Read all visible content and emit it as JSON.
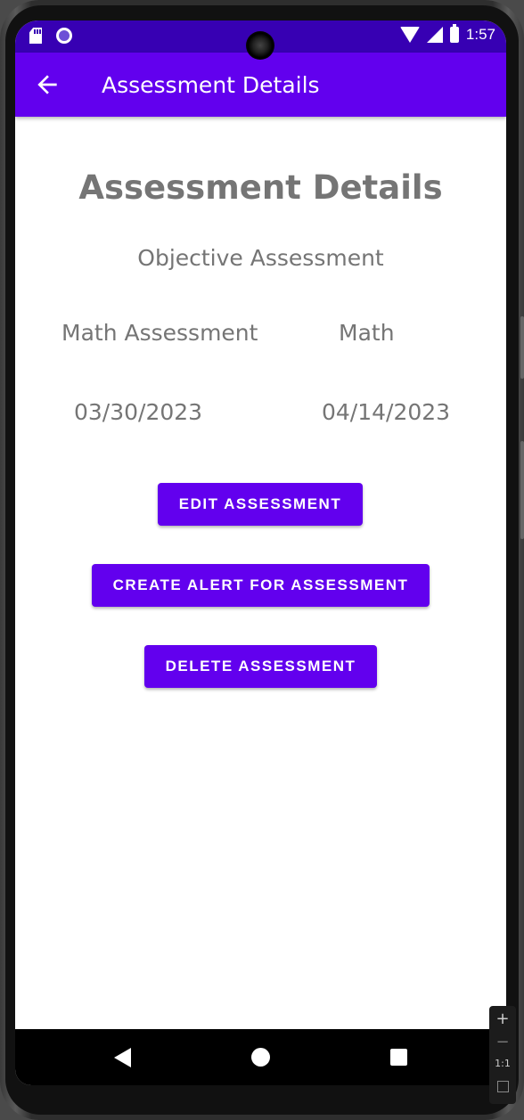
{
  "status_bar": {
    "time": "1:57",
    "icons": [
      "sd-card-icon",
      "circle-status-icon",
      "wifi-icon",
      "signal-icon",
      "battery-icon"
    ]
  },
  "app_bar": {
    "title": "Assessment Details",
    "back_icon": "arrow-back-icon"
  },
  "content": {
    "heading": "Assessment Details",
    "assessment_type": "Objective Assessment",
    "assessment_title": "Math Assessment",
    "course": "Math",
    "start_date": "03/30/2023",
    "end_date": "04/14/2023"
  },
  "buttons": {
    "edit": "EDIT ASSESSMENT",
    "create_alert": "CREATE ALERT FOR ASSESSMENT",
    "delete": "DELETE ASSESSMENT"
  },
  "nav_bar": {
    "icons": [
      "nav-back-icon",
      "nav-home-icon",
      "nav-recents-icon"
    ]
  },
  "emulator_zoom": {
    "zoom_in": "+",
    "zoom_out": "−",
    "actual_size": "1:1"
  },
  "colors": {
    "primary": "#6200ee",
    "primary_dark": "#3700b3",
    "text_gray": "#757575"
  }
}
